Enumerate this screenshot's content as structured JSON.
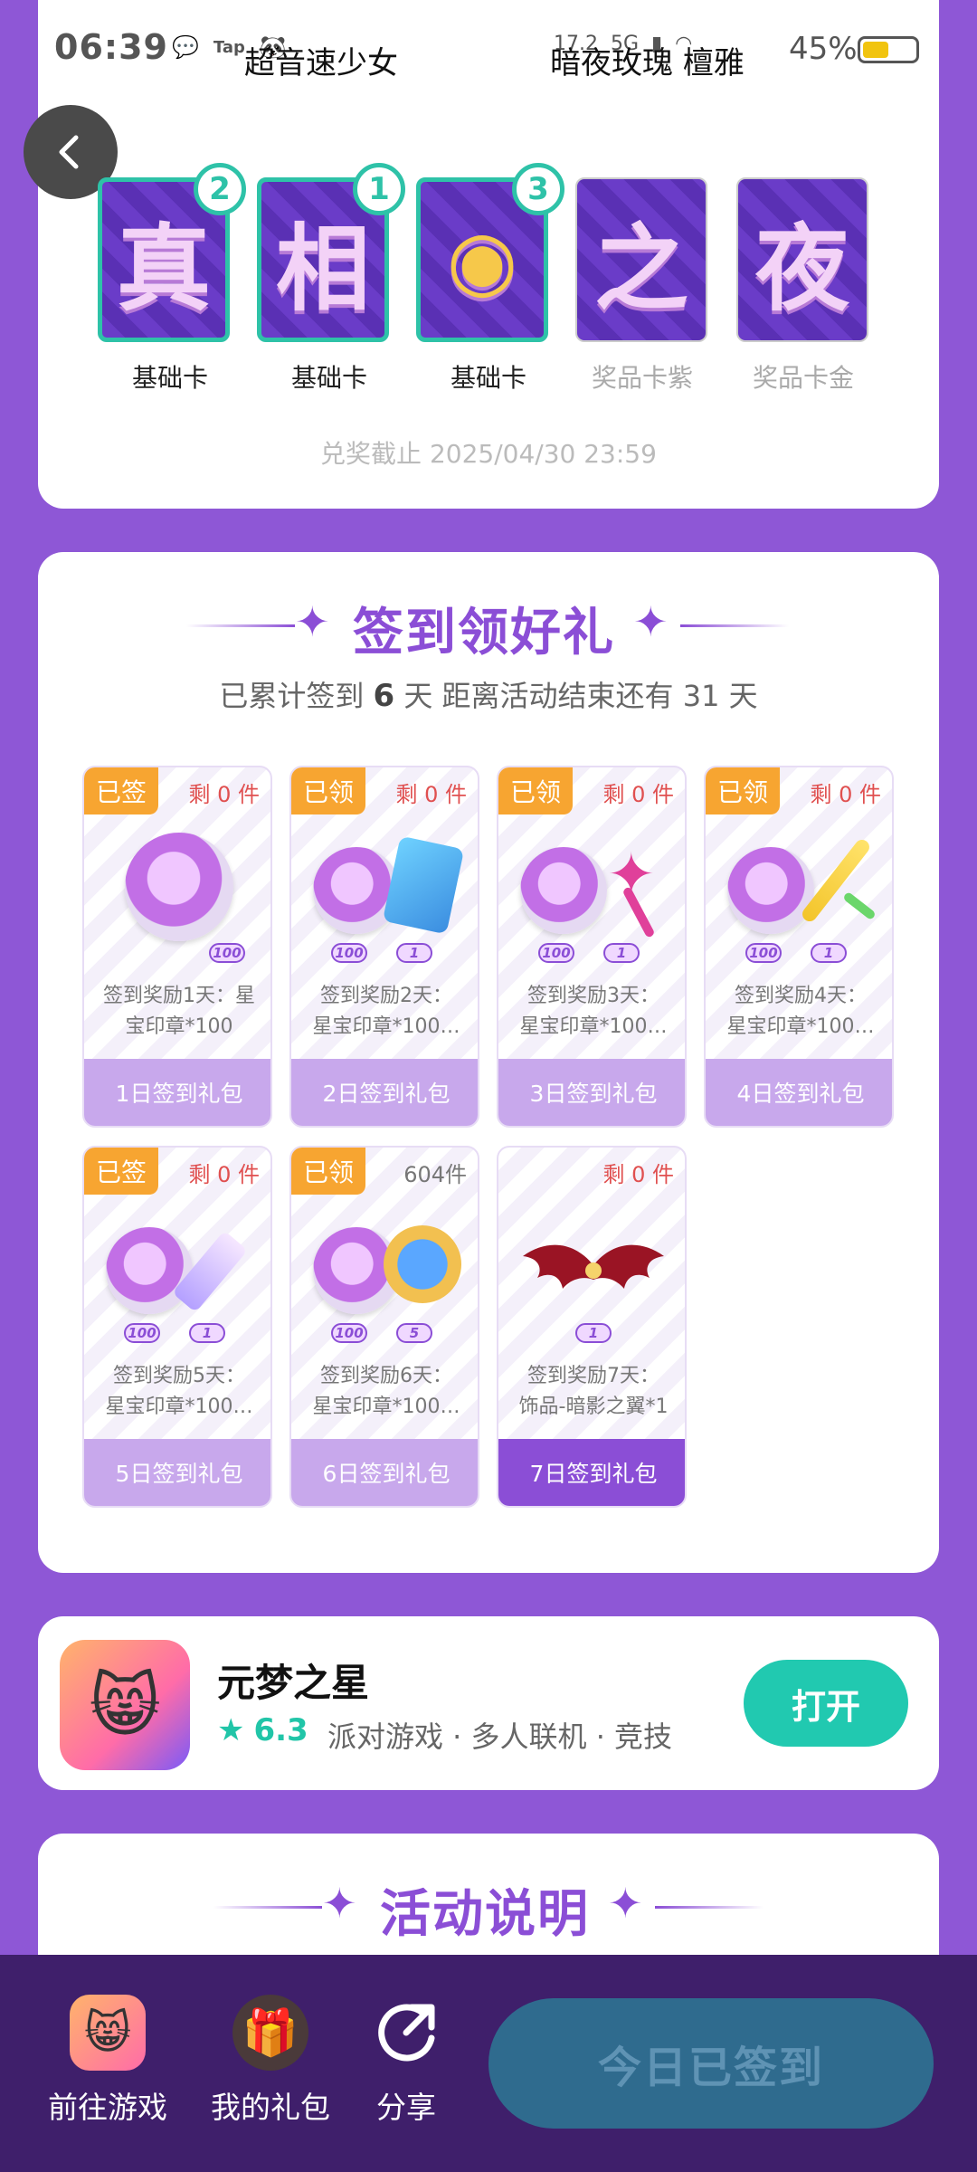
{
  "status_bar": {
    "time": "06:39",
    "app_icons": [
      "💬",
      "Tap",
      "🐼"
    ],
    "network": "17.2",
    "network_extra": "5G",
    "battery_percent": "45%"
  },
  "header": {
    "left_name": "超音速少女",
    "right_name": "暗夜玫瑰 檀雅"
  },
  "collect_cards": [
    {
      "char": "真",
      "label": "基础卡",
      "count": "2",
      "owned": true
    },
    {
      "char": "相",
      "label": "基础卡",
      "count": "1",
      "owned": true
    },
    {
      "char": "◉",
      "label": "基础卡",
      "count": "3",
      "owned": true
    },
    {
      "char": "之",
      "label": "奖品卡紫",
      "count": "",
      "owned": false
    },
    {
      "char": "夜",
      "label": "奖品卡金",
      "count": "",
      "owned": false
    }
  ],
  "deadline": "兑奖截止 2025/04/30 23:59",
  "signin": {
    "title": "签到领好礼",
    "summary_prefix": "已累计签到",
    "days": "6",
    "summary_mid": "天  距离活动结束还有",
    "remaining_days": "31",
    "summary_suffix": "天",
    "rewards": [
      {
        "tag": "已签",
        "remain": "剩 0 件",
        "desc1": "签到奖励1天：星",
        "desc2": "宝印章*100",
        "foot": "1日签到礼包",
        "qty": [
          "100"
        ]
      },
      {
        "tag": "已领",
        "remain": "剩 0 件",
        "desc1": "签到奖励2天：",
        "desc2": "星宝印章*100…",
        "foot": "2日签到礼包",
        "qty": [
          "100",
          "1"
        ]
      },
      {
        "tag": "已领",
        "remain": "剩 0 件",
        "desc1": "签到奖励3天：",
        "desc2": "星宝印章*100…",
        "foot": "3日签到礼包",
        "qty": [
          "100",
          "1"
        ]
      },
      {
        "tag": "已领",
        "remain": "剩 0 件",
        "desc1": "签到奖励4天：",
        "desc2": "星宝印章*100…",
        "foot": "4日签到礼包",
        "qty": [
          "100",
          "1"
        ]
      },
      {
        "tag": "已签",
        "remain": "剩 0 件",
        "desc1": "签到奖励5天：",
        "desc2": "星宝印章*100…",
        "foot": "5日签到礼包",
        "qty": [
          "100",
          "1"
        ]
      },
      {
        "tag": "已领",
        "remain": "604件",
        "desc1": "签到奖励6天：",
        "desc2": "星宝印章*100…",
        "foot": "6日签到礼包",
        "qty": [
          "100",
          "5"
        ]
      },
      {
        "tag": "",
        "remain": "剩 0 件",
        "desc1": "签到奖励7天：",
        "desc2": "饰品-暗影之翼*1",
        "foot": "7日签到礼包",
        "qty": [
          "1"
        ]
      }
    ]
  },
  "game": {
    "name": "元梦之星",
    "rating": "6.3",
    "tags": "派对游戏 · 多人联机 · 竞技",
    "open_label": "打开"
  },
  "description": {
    "title": "活动说明"
  },
  "bottom_nav": {
    "goto_game": "前往游戏",
    "my_gifts": "我的礼包",
    "share": "分享",
    "signed_today": "今日已签到"
  },
  "colors": {
    "background": "#8e57d6",
    "accent": "#8b4ed6",
    "teal": "#21c9b0",
    "tag_orange": "#f7a531"
  }
}
